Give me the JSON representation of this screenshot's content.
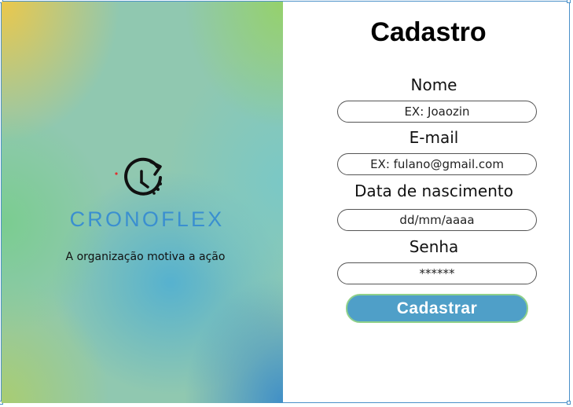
{
  "brand": {
    "logo_icon": "clock-arrow-icon",
    "name": "CRONOFLEX",
    "tagline": "A organização motiva a ação",
    "name_color": "#3a8fd0"
  },
  "form": {
    "title": "Cadastro",
    "fields": [
      {
        "label": "Nome",
        "placeholder": "EX: Joaozin"
      },
      {
        "label": "E-mail",
        "placeholder": "EX: fulano@gmail.com"
      },
      {
        "label": "Data de nascimento",
        "placeholder": "dd/mm/aaaa"
      },
      {
        "label": "Senha",
        "placeholder": "******"
      }
    ],
    "submit_label": "Cadastrar",
    "submit_color": "#4f9fc8",
    "submit_border_color": "#8fd08a"
  }
}
